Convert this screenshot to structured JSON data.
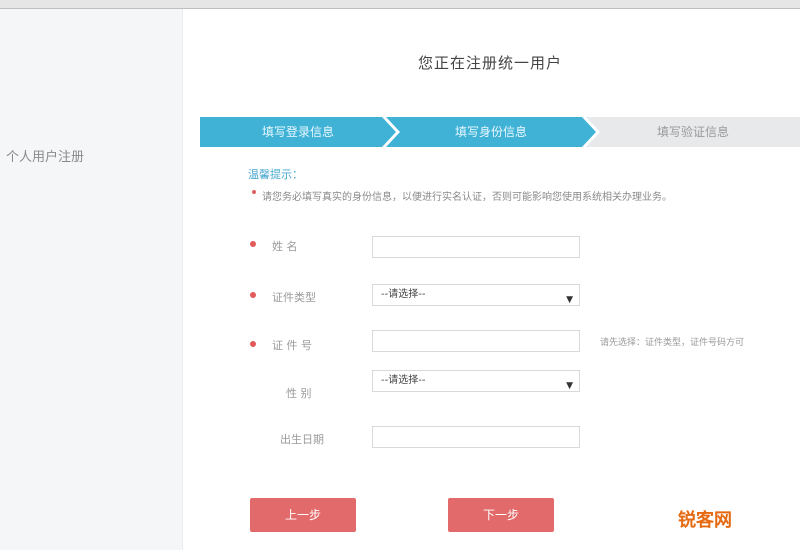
{
  "page_title": "您正在注册统一用户",
  "sidebar": {
    "label": "个人用户注册"
  },
  "steps": [
    "填写登录信息",
    "填写身份信息",
    "填写验证信息"
  ],
  "hint": {
    "title": "温馨提示：",
    "text": "请您务必填写真实的身份信息，以便进行实名认证，否则可能影响您使用系统相关办理业务。"
  },
  "form": {
    "name_label": "姓    名",
    "id_type_label": "证件类型",
    "id_type_value": "--请选择--",
    "id_number_label": "证 件 号",
    "id_number_hint": "请先选择：证件类型，证件号码方可",
    "gender_label": "性    别",
    "gender_value": "--请选择--",
    "birth_label": "出生日期"
  },
  "buttons": {
    "prev": "上一步",
    "next": "下一步"
  },
  "watermark": "锐客网",
  "colors": {
    "step_active": "#3fb2d6",
    "button": "#e36a6a",
    "required": "#e25a5a"
  }
}
